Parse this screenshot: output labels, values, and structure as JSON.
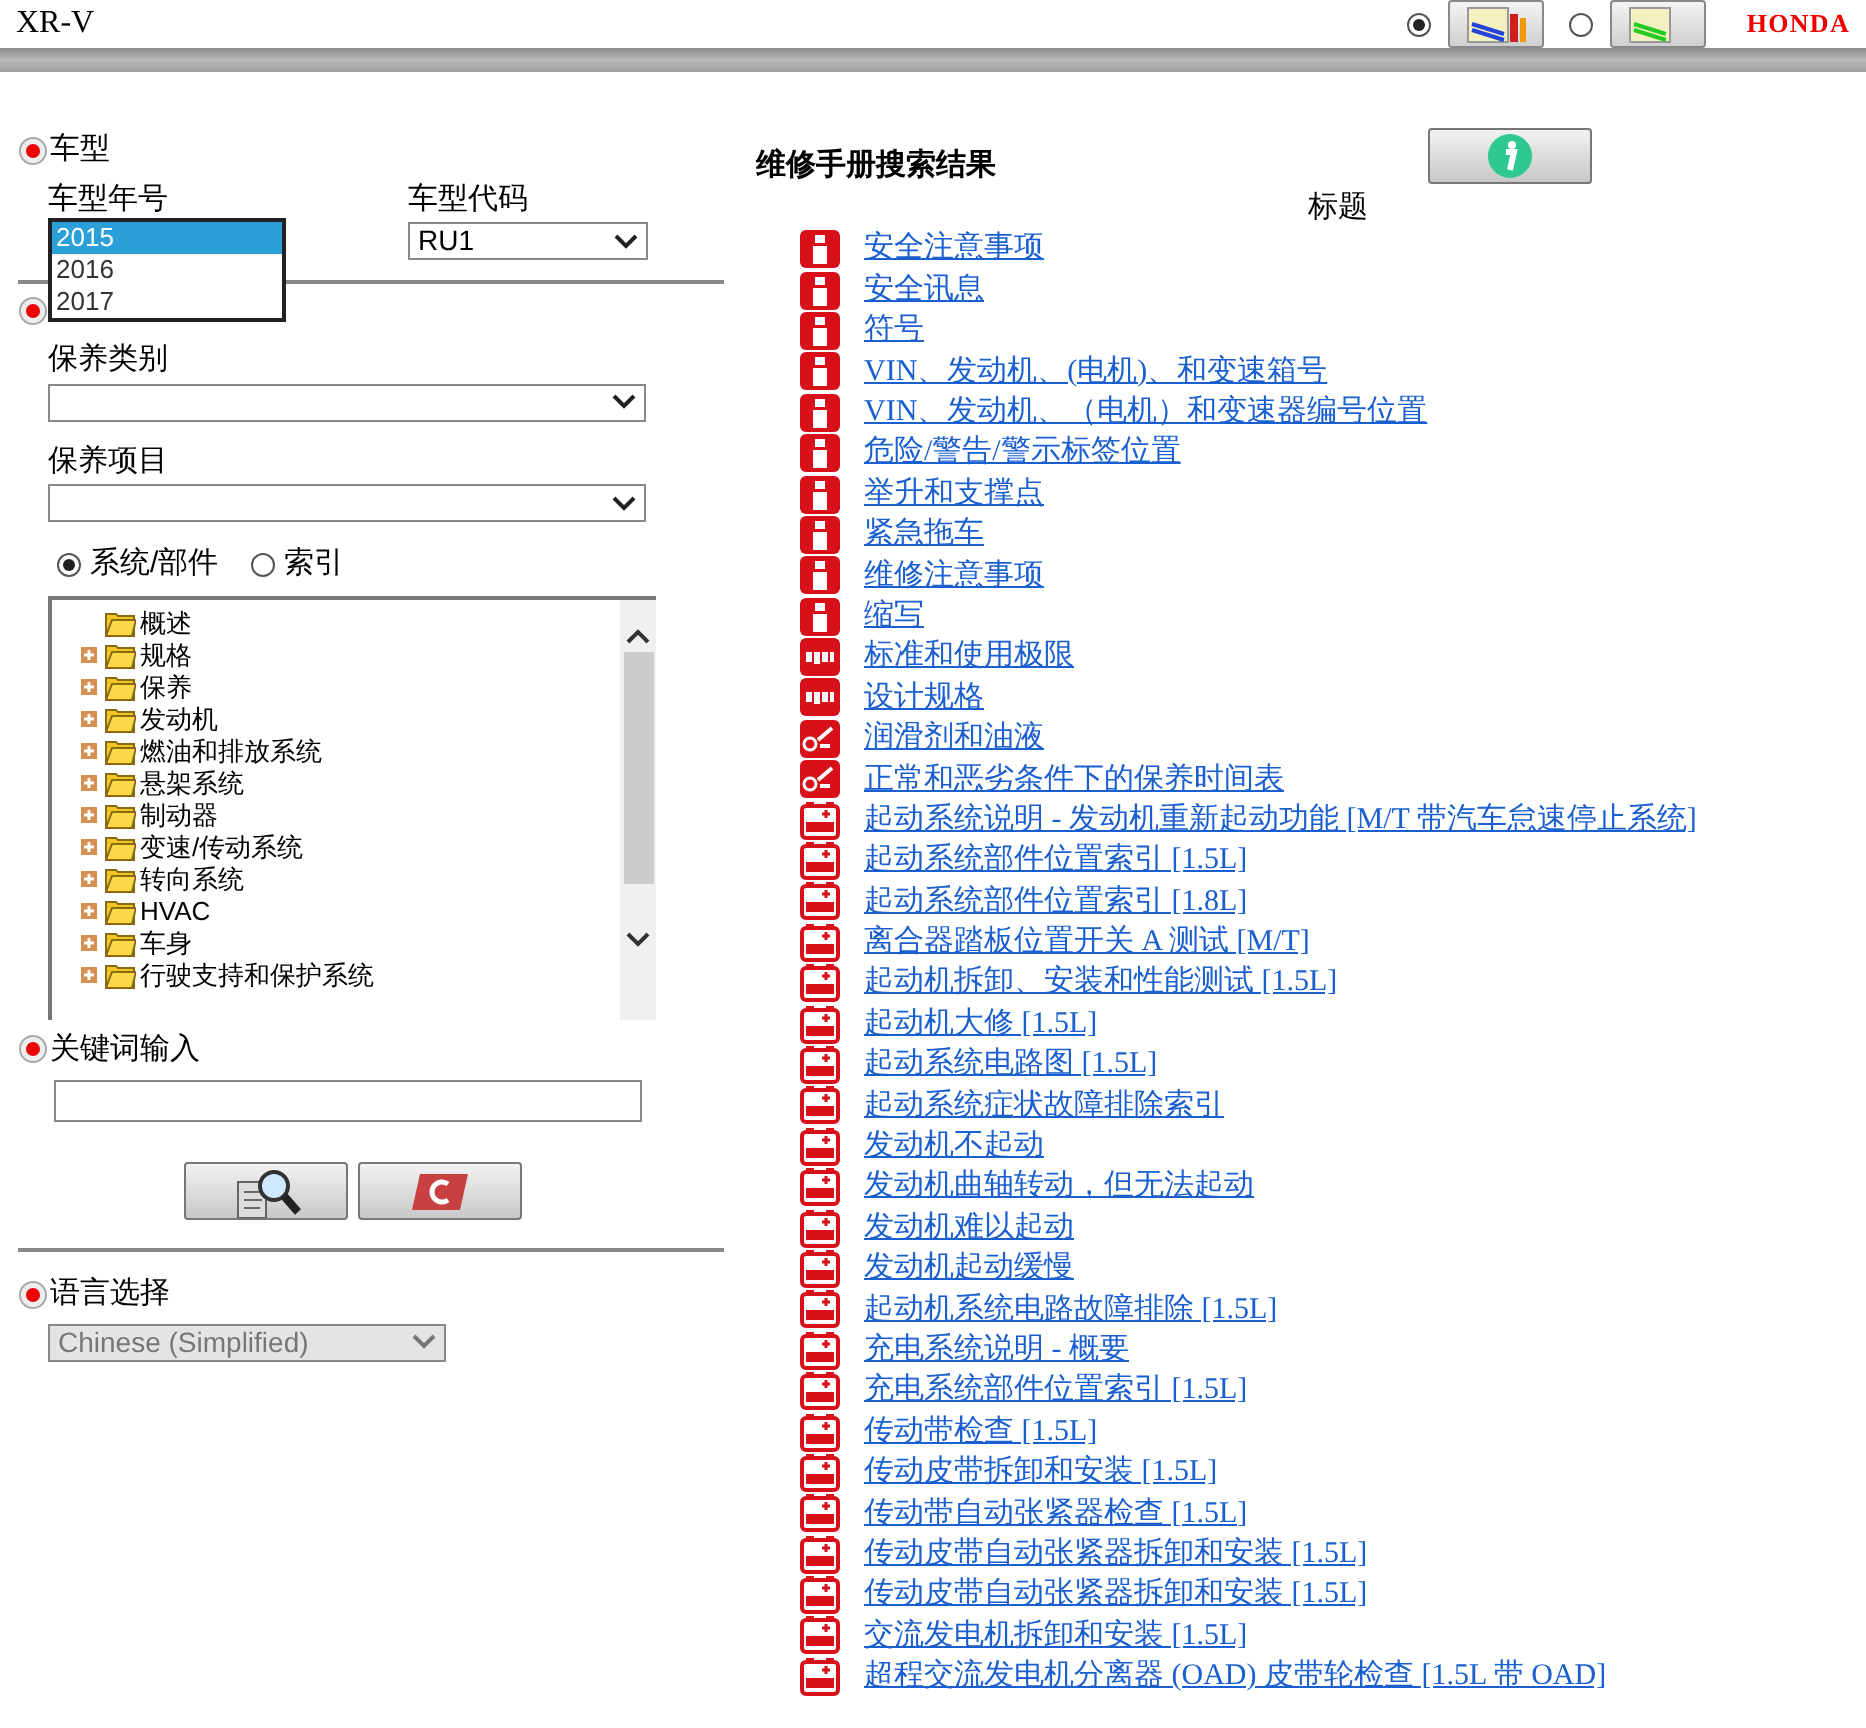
{
  "header": {
    "title": "XR-V",
    "view_options": [
      {
        "selected": true
      },
      {
        "selected": false
      }
    ],
    "brand": "HONDA"
  },
  "sidebar": {
    "model": {
      "label": "车型",
      "year_label": "车型年号",
      "year_options": [
        {
          "label": "2015",
          "selected": true
        },
        {
          "label": "2016",
          "selected": false
        },
        {
          "label": "2017",
          "selected": false
        }
      ],
      "code_label": "车型代码",
      "code_value": "RU1"
    },
    "item_search": {
      "category_label": "保养类别",
      "item_label": "保养项目",
      "modes": [
        {
          "label": "系统/部件",
          "selected": true
        },
        {
          "label": "索引",
          "selected": false
        }
      ],
      "tree": [
        {
          "label": "概述",
          "expandable": false
        },
        {
          "label": "规格",
          "expandable": true
        },
        {
          "label": "保养",
          "expandable": true
        },
        {
          "label": "发动机",
          "expandable": true
        },
        {
          "label": "燃油和排放系统",
          "expandable": true
        },
        {
          "label": "悬架系统",
          "expandable": true
        },
        {
          "label": "制动器",
          "expandable": true
        },
        {
          "label": "变速/传动系统",
          "expandable": true
        },
        {
          "label": "转向系统",
          "expandable": true
        },
        {
          "label": "HVAC",
          "expandable": true
        },
        {
          "label": "车身",
          "expandable": true
        },
        {
          "label": "行驶支持和保护系统",
          "expandable": true
        }
      ]
    },
    "keyword": {
      "label": "关键词输入"
    },
    "language": {
      "label": "语言选择",
      "value": "Chinese (Simplified)",
      "disabled": true
    }
  },
  "results": {
    "title": "维修手册搜索结果",
    "column": "标题",
    "rows": [
      {
        "kind": "info",
        "title": "安全注意事项"
      },
      {
        "kind": "info",
        "title": "安全讯息"
      },
      {
        "kind": "info",
        "title": "符号"
      },
      {
        "kind": "info",
        "title": "VIN、发动机、(电机)、和变速箱号"
      },
      {
        "kind": "info",
        "title": "VIN、发动机、（电机）和变速器编号位置"
      },
      {
        "kind": "info",
        "title": "危险/警告/警示标签位置"
      },
      {
        "kind": "info",
        "title": "举升和支撑点"
      },
      {
        "kind": "info",
        "title": "紧急拖车"
      },
      {
        "kind": "info",
        "title": "维修注意事项"
      },
      {
        "kind": "info",
        "title": "缩写"
      },
      {
        "kind": "specs",
        "title": "标准和使用极限"
      },
      {
        "kind": "specs",
        "title": "设计规格"
      },
      {
        "kind": "lube",
        "title": "润滑剂和油液"
      },
      {
        "kind": "lube",
        "title": "正常和恶劣条件下的保养时间表"
      },
      {
        "kind": "engine",
        "title": "起动系统说明 - 发动机重新起动功能 [M/T 带汽车怠速停止系统]"
      },
      {
        "kind": "engine",
        "title": "起动系统部件位置索引 [1.5L]"
      },
      {
        "kind": "engine",
        "title": "起动系统部件位置索引 [1.8L]"
      },
      {
        "kind": "engine",
        "title": "离合器踏板位置开关 A 测试 [M/T]"
      },
      {
        "kind": "engine",
        "title": "起动机拆卸、安装和性能测试 [1.5L]"
      },
      {
        "kind": "engine",
        "title": "起动机大修 [1.5L]"
      },
      {
        "kind": "engine",
        "title": "起动系统电路图 [1.5L]"
      },
      {
        "kind": "engine",
        "title": "起动系统症状故障排除索引"
      },
      {
        "kind": "engine",
        "title": "发动机不起动"
      },
      {
        "kind": "engine",
        "title": "发动机曲轴转动，但无法起动"
      },
      {
        "kind": "engine",
        "title": "发动机难以起动"
      },
      {
        "kind": "engine",
        "title": "发动机起动缓慢"
      },
      {
        "kind": "engine",
        "title": "起动机系统电路故障排除 [1.5L]"
      },
      {
        "kind": "engine",
        "title": "充电系统说明 - 概要"
      },
      {
        "kind": "engine",
        "title": "充电系统部件位置索引 [1.5L]"
      },
      {
        "kind": "engine",
        "title": "传动带检查 [1.5L]"
      },
      {
        "kind": "engine",
        "title": "传动皮带拆卸和安装 [1.5L]"
      },
      {
        "kind": "engine",
        "title": "传动带自动张紧器检查 [1.5L]"
      },
      {
        "kind": "engine",
        "title": "传动皮带自动张紧器拆卸和安装 [1.5L]"
      },
      {
        "kind": "engine",
        "title": "传动皮带自动张紧器拆卸和安装 [1.5L]"
      },
      {
        "kind": "engine",
        "title": "交流发电机拆卸和安装 [1.5L]"
      },
      {
        "kind": "engine",
        "title": "超程交流发电机分离器 (OAD) 皮带轮检查 [1.5L 带 OAD]"
      }
    ]
  }
}
